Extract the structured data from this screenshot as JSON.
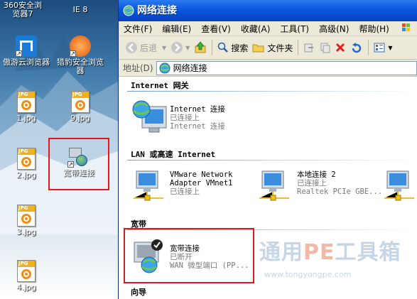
{
  "desktop": {
    "icons": [
      {
        "label": "360安全浏览器7"
      },
      {
        "label": "IE 8"
      },
      {
        "label": "傲游云浏览器"
      },
      {
        "label": "猎豹安全浏览器"
      },
      {
        "label": "1.jpg"
      },
      {
        "label": "9.jpg"
      },
      {
        "label": "2.jpg"
      },
      {
        "label": "宽带连接"
      },
      {
        "label": "3.jpg"
      },
      {
        "label": "4.jpg"
      }
    ],
    "jpg_tag": "JPG"
  },
  "window": {
    "title": "网络连接",
    "menu": [
      "文件(F)",
      "编辑(E)",
      "查看(V)",
      "收藏(A)",
      "工具(T)",
      "高级(N)",
      "帮助(H)"
    ],
    "toolbar": {
      "back": "后退",
      "search": "搜索",
      "folders": "文件夹"
    },
    "address": {
      "label": "地址(D)",
      "value": "网络连接"
    },
    "groups": {
      "internet": "Internet 网关",
      "lan": "LAN 或高速 Internet",
      "broadband": "宽带",
      "wizard": "向导"
    },
    "items": {
      "internet_gw": {
        "name": "Internet 连接",
        "status": "已连接上",
        "detail": "Internet 连接"
      },
      "vmnet": {
        "name": "VMware Network",
        "name2": "Adapter VMnet1",
        "status": "已连接上"
      },
      "local2": {
        "name": "本地连接 2",
        "status": "已连接上",
        "detail": "Realtek PCIe GBE..."
      },
      "broadband": {
        "name": "宽带连接",
        "status": "已断开",
        "detail": "WAN 微型端口 (PP..."
      }
    }
  },
  "watermark": {
    "text_a": "通用",
    "text_pe": "PE",
    "text_b": "工具箱",
    "url": "www.tongyongpe.com"
  },
  "colors": {
    "title_blue": "#0a5ae0",
    "highlight_red": "#e0181f",
    "jpg_orange": "#ef8d1b"
  }
}
